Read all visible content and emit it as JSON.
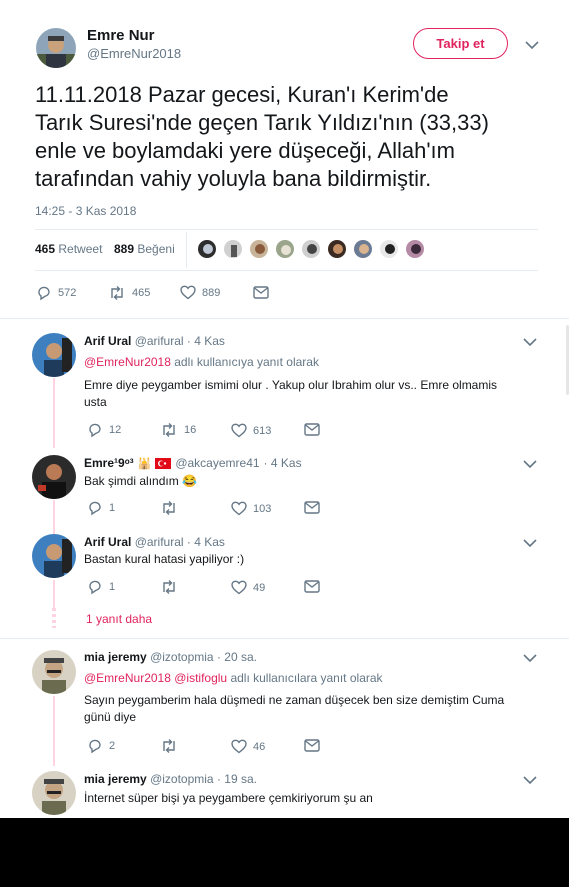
{
  "main_tweet": {
    "author_name": "Emre Nur",
    "author_handle": "@EmreNur2018",
    "follow_label": "Takip et",
    "text_lines": [
      "11.11.2018 Pazar gecesi, Kuran'ı Kerim'de",
      "Tarık Suresi'nde geçen Tarık Yıldızı'nın (33,33)",
      "enle ve boylamdaki yere düşeceği, Allah'ım",
      "tarafından vahiy yoluyla bana bildirmiştir."
    ],
    "timestamp": "14:25 - 3 Kas 2018",
    "retweet_count": "465",
    "retweet_label": "Retweet",
    "like_count": "889",
    "like_label": "Beğeni",
    "actions": {
      "replies": "572",
      "retweets": "465",
      "likes": "889"
    }
  },
  "replies": [
    {
      "name": "Arif Ural",
      "handle": "@arifural",
      "time": "· 4 Kas",
      "reply_to_handle": "@EmreNur2018",
      "reply_to_text": "adlı kullanıcıya yanıt olarak",
      "text_lines": [
        "Emre diye peygamber ismimi olur . Yakup olur Ibrahim olur vs.. Emre olmamis",
        "usta"
      ],
      "replies": "12",
      "retweets": "16",
      "likes": "613"
    },
    {
      "name": "Emre",
      "name_suffix": "¹9ᵒ³",
      "handle": "@akcayemre41",
      "time": "· 4 Kas",
      "text_lines": [
        "Bak şimdi alındım 😂"
      ],
      "replies": "1",
      "retweets": "",
      "likes": "103"
    },
    {
      "name": "Arif Ural",
      "handle": "@arifural",
      "time": "· 4 Kas",
      "text_lines": [
        "Bastan kural hatasi yapiliyor :)"
      ],
      "replies": "1",
      "retweets": "",
      "likes": "49"
    },
    {
      "more_label": "1 yanıt daha"
    },
    {
      "name": "mia jeremy",
      "handle": "@izotopmia",
      "time": "· 20 sa.",
      "reply_to_handle": "@EmreNur2018",
      "reply_to_handle2": "@istifoglu",
      "reply_to_text": "adlı kullanıcılara yanıt olarak",
      "text_lines": [
        "Sayın peygamberim hala düşmedi ne zaman düşecek ben size demiştim Cuma",
        "günü diye"
      ],
      "replies": "2",
      "retweets": "",
      "likes": "46"
    },
    {
      "name": "mia jeremy",
      "handle": "@izotopmia",
      "time": "· 19 sa.",
      "text_lines": [
        "İnternet süper bişi ya peygambere çemkiriyorum şu an"
      ]
    }
  ],
  "colors": {
    "accent": "#e0245e",
    "thread_line": "#ffd3e1",
    "muted": "#657786",
    "divider": "#e6ecf0"
  },
  "icons": [
    "chevron-down-icon",
    "reply-icon",
    "retweet-icon",
    "heart-icon",
    "mail-icon",
    "flag-icon",
    "mosque-icon"
  ]
}
